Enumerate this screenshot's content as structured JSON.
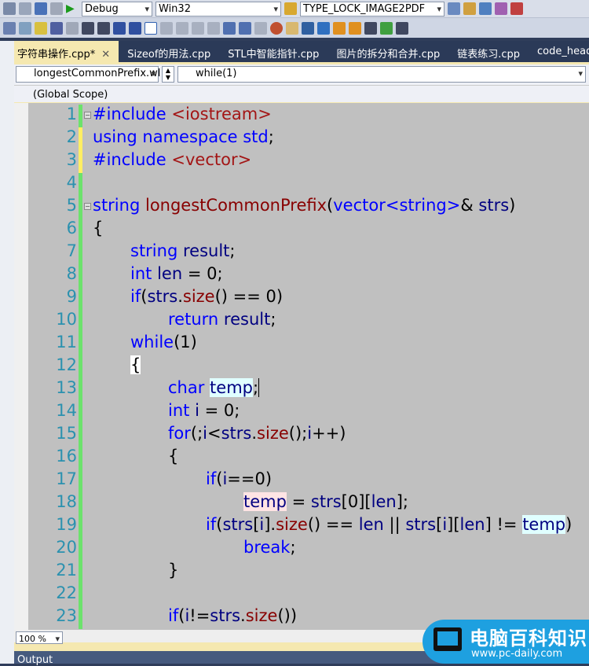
{
  "toolbar": {
    "config": "Debug",
    "platform": "Win32",
    "project": "TYPE_LOCK_IMAGE2PDF"
  },
  "tabs": [
    {
      "label": "字符串操作.cpp*",
      "active": true
    },
    {
      "label": "Sizeof的用法.cpp"
    },
    {
      "label": "STL中智能指针.cpp"
    },
    {
      "label": "图片的拆分和合并.cpp"
    },
    {
      "label": "链表练习.cpp"
    },
    {
      "label": "code_head.h"
    }
  ],
  "nav": {
    "function": "longestCommonPrefix.wl",
    "member": "while(1)",
    "scope": "(Global Scope)"
  },
  "status": {
    "zoom": "100 %"
  },
  "output": {
    "title": "Output"
  },
  "watermark": {
    "title": "电脑百科知识",
    "url": "www.pc-daily.com"
  },
  "colors": {
    "keyword": "#0000ff",
    "identifier": "#000080",
    "function": "#880000",
    "string": "#a31515",
    "line_number": "#2b91af",
    "background": "#c0c0c0"
  },
  "code": [
    {
      "n": "1",
      "i": 0,
      "t": [
        [
          "#include",
          "kw"
        ],
        [
          " ",
          "p"
        ],
        [
          "<iostream>",
          "str"
        ]
      ]
    },
    {
      "n": "2",
      "i": 0,
      "t": [
        [
          "using namespace std",
          "kw"
        ],
        [
          ";",
          "p"
        ]
      ]
    },
    {
      "n": "3",
      "i": 0,
      "t": [
        [
          "#include",
          "kw"
        ],
        [
          " ",
          "p"
        ],
        [
          "<vector>",
          "str"
        ]
      ]
    },
    {
      "n": "4",
      "i": 0,
      "t": []
    },
    {
      "n": "5",
      "i": 0,
      "t": [
        [
          "string",
          "kw"
        ],
        [
          " ",
          "p"
        ],
        [
          "longestCommonPrefix",
          "fn"
        ],
        [
          "(",
          "p"
        ],
        [
          "vector<string>",
          "kw"
        ],
        [
          "& ",
          "p"
        ],
        [
          "strs",
          "id"
        ],
        [
          ")",
          "p"
        ]
      ]
    },
    {
      "n": "6",
      "i": 0,
      "t": [
        [
          "{",
          "p"
        ]
      ]
    },
    {
      "n": "7",
      "i": 1,
      "t": [
        [
          "string",
          "kw"
        ],
        [
          " ",
          "p"
        ],
        [
          "result",
          "id"
        ],
        [
          ";",
          "p"
        ]
      ]
    },
    {
      "n": "8",
      "i": 1,
      "t": [
        [
          "int",
          "kw"
        ],
        [
          " ",
          "p"
        ],
        [
          "len",
          "id"
        ],
        [
          " = 0;",
          "p"
        ]
      ]
    },
    {
      "n": "9",
      "i": 1,
      "t": [
        [
          "if",
          "kw"
        ],
        [
          "(",
          "p"
        ],
        [
          "strs",
          "id"
        ],
        [
          ".",
          "p"
        ],
        [
          "size",
          "fn"
        ],
        [
          "() == 0)",
          "p"
        ]
      ]
    },
    {
      "n": "10",
      "i": 2,
      "t": [
        [
          "return",
          "kw"
        ],
        [
          " ",
          "p"
        ],
        [
          "result",
          "id"
        ],
        [
          ";",
          "p"
        ]
      ]
    },
    {
      "n": "11",
      "i": 1,
      "t": [
        [
          "while",
          "kw"
        ],
        [
          "(1)",
          "p"
        ]
      ]
    },
    {
      "n": "12",
      "i": 1,
      "t": [
        [
          "{",
          "p hw"
        ]
      ]
    },
    {
      "n": "13",
      "i": 2,
      "t": [
        [
          "char",
          "kw"
        ],
        [
          " ",
          "p"
        ],
        [
          "temp",
          "id hl"
        ],
        [
          ";",
          "p"
        ],
        [
          "",
          "caret"
        ]
      ]
    },
    {
      "n": "14",
      "i": 2,
      "t": [
        [
          "int",
          "kw"
        ],
        [
          " ",
          "p"
        ],
        [
          "i",
          "id"
        ],
        [
          " = 0;",
          "p"
        ]
      ]
    },
    {
      "n": "15",
      "i": 2,
      "t": [
        [
          "for",
          "kw"
        ],
        [
          "(;",
          "p"
        ],
        [
          "i",
          "id"
        ],
        [
          "<",
          "p"
        ],
        [
          "strs",
          "id"
        ],
        [
          ".",
          "p"
        ],
        [
          "size",
          "fn"
        ],
        [
          "();",
          "p"
        ],
        [
          "i",
          "id"
        ],
        [
          "++)",
          "p"
        ]
      ]
    },
    {
      "n": "16",
      "i": 2,
      "t": [
        [
          "{",
          "p"
        ]
      ]
    },
    {
      "n": "17",
      "i": 3,
      "t": [
        [
          "if",
          "kw"
        ],
        [
          "(",
          "p"
        ],
        [
          "i",
          "id"
        ],
        [
          "==0)",
          "p"
        ]
      ]
    },
    {
      "n": "18",
      "i": 4,
      "t": [
        [
          "temp",
          "id hr"
        ],
        [
          " = ",
          "p"
        ],
        [
          "strs",
          "id"
        ],
        [
          "[0][",
          "p"
        ],
        [
          "len",
          "id"
        ],
        [
          "];",
          "p"
        ]
      ]
    },
    {
      "n": "19",
      "i": 3,
      "t": [
        [
          "if",
          "kw"
        ],
        [
          "(",
          "p"
        ],
        [
          "strs",
          "id"
        ],
        [
          "[",
          "p"
        ],
        [
          "i",
          "id"
        ],
        [
          "].",
          "p"
        ],
        [
          "size",
          "fn"
        ],
        [
          "() == ",
          "p"
        ],
        [
          "len",
          "id"
        ],
        [
          " || ",
          "p"
        ],
        [
          "strs",
          "id"
        ],
        [
          "[",
          "p"
        ],
        [
          "i",
          "id"
        ],
        [
          "][",
          "p"
        ],
        [
          "len",
          "id"
        ],
        [
          "] != ",
          "p"
        ],
        [
          "temp",
          "id hl"
        ],
        [
          ")",
          "p"
        ]
      ]
    },
    {
      "n": "20",
      "i": 4,
      "t": [
        [
          "break",
          "kw"
        ],
        [
          ";",
          "p"
        ]
      ]
    },
    {
      "n": "21",
      "i": 2,
      "t": [
        [
          "}",
          "p"
        ]
      ]
    },
    {
      "n": "22",
      "i": 0,
      "t": []
    },
    {
      "n": "23",
      "i": 2,
      "t": [
        [
          "if",
          "kw"
        ],
        [
          "(",
          "p"
        ],
        [
          "i",
          "id"
        ],
        [
          "!=",
          "p"
        ],
        [
          "strs",
          "id"
        ],
        [
          ".",
          "p"
        ],
        [
          "size",
          "fn"
        ],
        [
          "())",
          "p"
        ]
      ]
    }
  ]
}
